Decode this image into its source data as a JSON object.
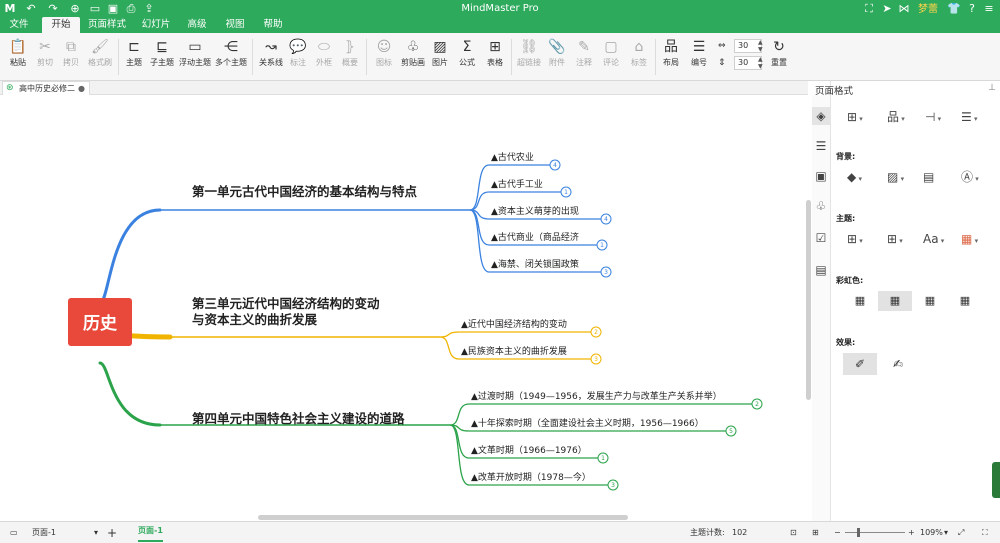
{
  "titlebar": {
    "app_title": "MindMaster Pro",
    "user_name": "梦蕾",
    "icons": [
      "app-logo",
      "undo",
      "redo",
      "new-file",
      "open-folder",
      "save",
      "print",
      "export"
    ]
  },
  "menu_tabs": [
    "文件",
    "开始",
    "页面样式",
    "幻灯片",
    "高级",
    "视图",
    "帮助"
  ],
  "menu_active": "开始",
  "ribbon": {
    "clipboard": [
      {
        "label": "粘贴",
        "icon": "paste-icon",
        "disabled": false
      },
      {
        "label": "剪切",
        "icon": "cut-icon",
        "disabled": true
      },
      {
        "label": "拷贝",
        "icon": "copy-icon",
        "disabled": true
      },
      {
        "label": "格式刷",
        "icon": "format-brush-icon",
        "disabled": true
      }
    ],
    "topics": [
      {
        "label": "主题",
        "icon": "topic-icon",
        "disabled": false
      },
      {
        "label": "子主题",
        "icon": "subtopic-icon",
        "disabled": false
      },
      {
        "label": "浮动主题",
        "icon": "floating-topic-icon",
        "disabled": false
      },
      {
        "label": "多个主题",
        "icon": "multiple-topics-icon",
        "disabled": false
      }
    ],
    "relations": [
      {
        "label": "关系线",
        "icon": "relationship-icon",
        "disabled": false
      },
      {
        "label": "标注",
        "icon": "callout-icon",
        "disabled": true
      },
      {
        "label": "外框",
        "icon": "boundary-icon",
        "disabled": true
      },
      {
        "label": "概要",
        "icon": "summary-icon",
        "disabled": true
      }
    ],
    "insert": [
      {
        "label": "图标",
        "icon": "icon-icon",
        "disabled": true
      },
      {
        "label": "剪贴画",
        "icon": "clipart-icon",
        "disabled": false
      },
      {
        "label": "图片",
        "icon": "picture-icon",
        "disabled": false
      },
      {
        "label": "公式",
        "icon": "formula-icon",
        "disabled": false
      },
      {
        "label": "表格",
        "icon": "table-icon",
        "disabled": false
      }
    ],
    "attach": [
      {
        "label": "超链接",
        "icon": "hyperlink-icon",
        "disabled": true
      },
      {
        "label": "附件",
        "icon": "attachment-icon",
        "disabled": true
      },
      {
        "label": "注释",
        "icon": "note-icon",
        "disabled": true
      },
      {
        "label": "评论",
        "icon": "comment-icon",
        "disabled": true
      },
      {
        "label": "标签",
        "icon": "tag-icon",
        "disabled": true
      }
    ],
    "layout": [
      {
        "label": "布局",
        "icon": "layout-icon",
        "disabled": false
      },
      {
        "label": "编号",
        "icon": "numbering-icon",
        "disabled": false
      }
    ],
    "spacing": [
      "30",
      "30"
    ],
    "reset": {
      "label": "重置",
      "icon": "reset-icon"
    }
  },
  "document": {
    "tab_title": "高中历史必修二"
  },
  "mindmap": {
    "central": {
      "text": "历史",
      "color": "#e8493a"
    },
    "branches": [
      {
        "lines": [
          "第一单元古代中国经济的基本结构与特点"
        ],
        "color": "#3b82e0",
        "children": [
          {
            "text": "▲古代农业",
            "badge": "4"
          },
          {
            "text": "▲古代手工业",
            "badge": "1"
          },
          {
            "text": "▲资本主义萌芽的出现",
            "badge": "4"
          },
          {
            "text": "▲古代商业（商品经济",
            "badge": "1"
          },
          {
            "text": "▲海禁、闭关锁国政策",
            "badge": "3"
          }
        ]
      },
      {
        "lines": [
          "第三单元近代中国经济结构的变动",
          "与资本主义的曲折发展"
        ],
        "color": "#f0b400",
        "children": [
          {
            "text": "▲近代中国经济结构的变动",
            "badge": "2"
          },
          {
            "text": "▲民族资本主义的曲折发展",
            "badge": "3"
          }
        ]
      },
      {
        "lines": [
          "第四单元中国特色社会主义建设的道路"
        ],
        "color": "#2ba34a",
        "children": [
          {
            "text": "▲过渡时期（1949—1956，发展生产力与改革生产关系并举）",
            "badge": "2"
          },
          {
            "text": "▲十年探索时期（全面建设社会主义时期，1956—1966）",
            "badge": "5"
          },
          {
            "text": "▲文革时期（1966—1976）",
            "badge": "1"
          },
          {
            "text": "▲改革开放时期（1978—今）",
            "badge": "3"
          }
        ]
      }
    ]
  },
  "panel": {
    "title": "页面格式",
    "background_label": "背景:",
    "theme_label": "主题:",
    "rainbow_label": "彩虹色:",
    "effect_label": "效果:",
    "font_label": "Aa"
  },
  "statusbar": {
    "page_select": "页面-1",
    "page_tab": "页面-1",
    "topic_count_label": "主题计数:",
    "topic_count": "102",
    "zoom": "109%"
  }
}
